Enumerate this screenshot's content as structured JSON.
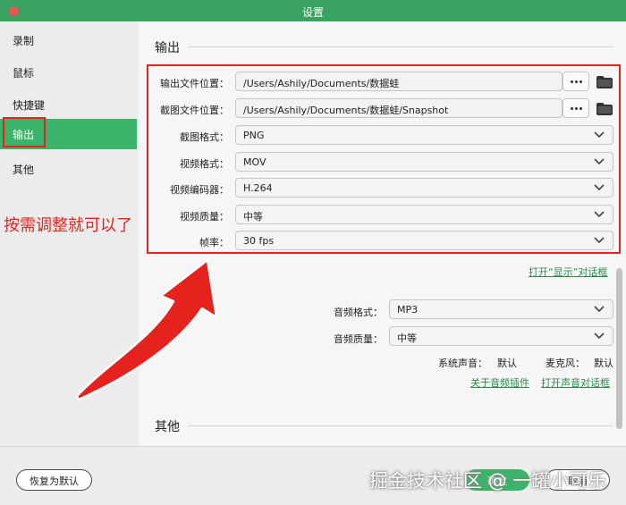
{
  "window": {
    "title": "设置"
  },
  "sidebar": {
    "items": [
      {
        "label": "录制"
      },
      {
        "label": "鼠标"
      },
      {
        "label": "快捷键"
      },
      {
        "label": "输出"
      },
      {
        "label": "其他"
      }
    ],
    "active": "输出"
  },
  "output": {
    "section_title": "输出",
    "rows": [
      {
        "label": "输出文件位置：",
        "value": "/Users/Ashily/Documents/数据蛙"
      },
      {
        "label": "截图文件位置：",
        "value": "/Users/Ashily/Documents/数据蛙/Snapshot"
      },
      {
        "label": "截图格式：",
        "value": "PNG"
      },
      {
        "label": "视频格式：",
        "value": "MOV"
      },
      {
        "label": "视频编码器：",
        "value": "H.264"
      },
      {
        "label": "视频质量：",
        "value": "中等"
      },
      {
        "label": "帧率：",
        "value": "30 fps"
      }
    ],
    "show_dialog_link": "打开“显示”对话框"
  },
  "audio": {
    "format_label": "音频格式：",
    "format_value": "MP3",
    "quality_label": "音频质量：",
    "quality_value": "中等",
    "system_sound_label": "系统声音：",
    "system_sound_value": "默认",
    "mic_label": "麦克风：",
    "mic_value": "默认",
    "plugin_link": "关于音频插件",
    "sound_dialog_link": "打开声音对话框"
  },
  "other": {
    "section_title": "其他"
  },
  "annotation": {
    "text": "按需调整就可以了"
  },
  "footer": {
    "reset_label": "恢复为默认",
    "ok_label": "确定",
    "cancel_label": "取消",
    "watermark": "掘金技术社区 @ 一罐小可乐"
  },
  "colors": {
    "accent": "#3cb36a",
    "titlebar": "#3aa261",
    "annotation_red": "#e5221e",
    "link": "#2b8a4c"
  }
}
